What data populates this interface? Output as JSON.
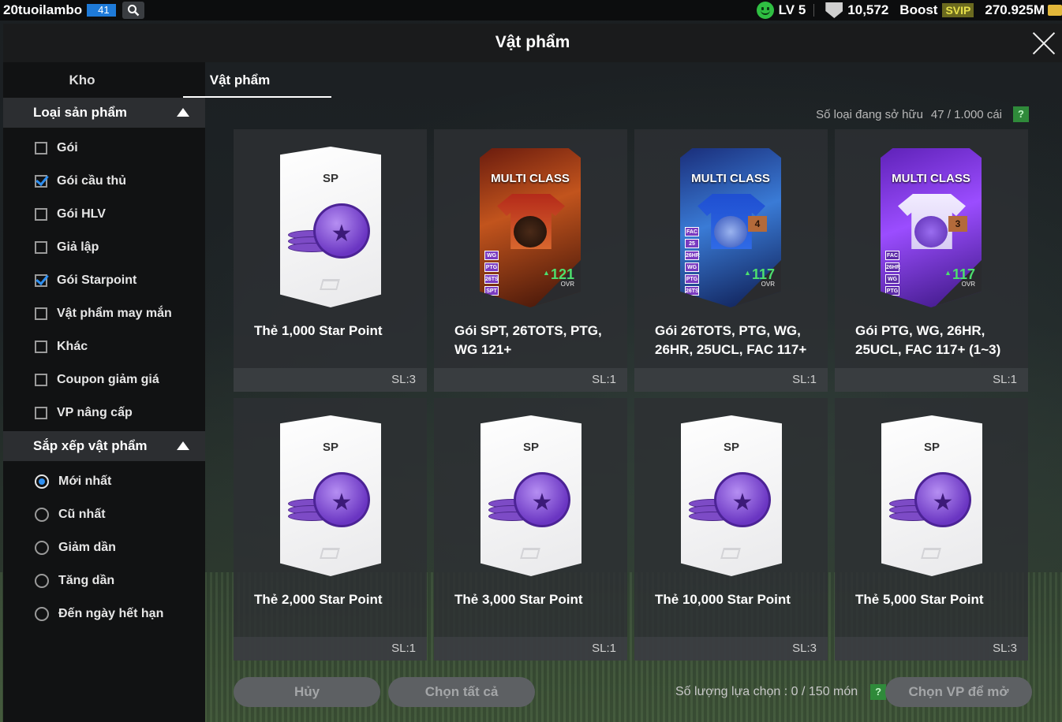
{
  "topbar": {
    "username": "20tuoilambo",
    "user_level_badge": "41",
    "level_text": "LV 5",
    "trophy_count": "10,572",
    "boost_label": "Boost",
    "svip_label": "SVIP",
    "coins": "270.925M"
  },
  "dialog": {
    "title": "Vật phẩm",
    "tabs": [
      "Kho",
      "Vật phẩm"
    ],
    "active_tab": "Vật phẩm"
  },
  "filters": {
    "section_title": "Loại sản phẩm",
    "items": [
      {
        "label": "Gói",
        "checked": false
      },
      {
        "label": "Gói cầu thủ",
        "checked": true
      },
      {
        "label": "Gói HLV",
        "checked": false
      },
      {
        "label": "Giả lập",
        "checked": false
      },
      {
        "label": "Gói Starpoint",
        "checked": true
      },
      {
        "label": "Vật phẩm may mắn",
        "checked": false
      },
      {
        "label": "Khác",
        "checked": false
      },
      {
        "label": "Coupon giảm giá",
        "checked": false
      },
      {
        "label": "VP nâng cấp",
        "checked": false
      }
    ]
  },
  "sort": {
    "section_title": "Sắp xếp vật phẩm",
    "options": [
      {
        "label": "Mới nhất",
        "selected": true
      },
      {
        "label": "Cũ nhất",
        "selected": false
      },
      {
        "label": "Giảm dần",
        "selected": false
      },
      {
        "label": "Tăng dần",
        "selected": false
      },
      {
        "label": "Đến ngày hết hạn",
        "selected": false
      }
    ]
  },
  "owned": {
    "label": "Số loại đang sở hữu",
    "value": "47 / 1.000 cái",
    "help": "?"
  },
  "items": [
    {
      "kind": "sp",
      "sp_label": "SP",
      "name": "Thẻ 1,000 Star Point",
      "qty": "SL:3"
    },
    {
      "kind": "mc",
      "card_title": "MULTI CLASS",
      "name": "Gói SPT, 26TOTS, PTG, WG 121+",
      "qty": "SL:1",
      "ovr": "121",
      "ovr_label": "OVR",
      "chips": [
        "WG",
        "PTG",
        "26TS",
        "SPT"
      ],
      "rank": "",
      "theme": "fire"
    },
    {
      "kind": "mc",
      "card_title": "MULTI CLASS",
      "name": "Gói 26TOTS, PTG, WG, 26HR, 25UCL, FAC 117+",
      "qty": "SL:1",
      "ovr": "117",
      "ovr_label": "OVR",
      "chips": [
        "FAC",
        "25",
        "26HR",
        "WG",
        "PTG",
        "26TS"
      ],
      "rank": "4",
      "theme": "blue"
    },
    {
      "kind": "mc",
      "card_title": "MULTI CLASS",
      "name": "Gói PTG, WG, 26HR, 25UCL, FAC 117+ (1~3)",
      "qty": "SL:1",
      "ovr": "117",
      "ovr_label": "OVR",
      "chips": [
        "FAC",
        "26HR",
        "WG",
        "PTG"
      ],
      "rank": "3",
      "theme": "purple"
    },
    {
      "kind": "sp",
      "sp_label": "SP",
      "name": "Thẻ 2,000 Star Point",
      "qty": "SL:1"
    },
    {
      "kind": "sp",
      "sp_label": "SP",
      "name": "Thẻ 3,000 Star Point",
      "qty": "SL:1"
    },
    {
      "kind": "sp",
      "sp_label": "SP",
      "name": "Thẻ 10,000 Star Point",
      "qty": "SL:3"
    },
    {
      "kind": "sp",
      "sp_label": "SP",
      "name": "Thẻ 5,000 Star Point",
      "qty": "SL:3"
    }
  ],
  "bottom": {
    "cancel_label": "Hủy",
    "select_all_label": "Chọn tất cả",
    "selection_label": "Số lượng lựa chọn : 0 / 150 món",
    "help": "?",
    "open_label": "Chọn VP để mở"
  },
  "colors": {
    "accent": "#2f8ff0",
    "ovr_green": "#4ddf6e",
    "help_green": "#2f8a3a"
  }
}
